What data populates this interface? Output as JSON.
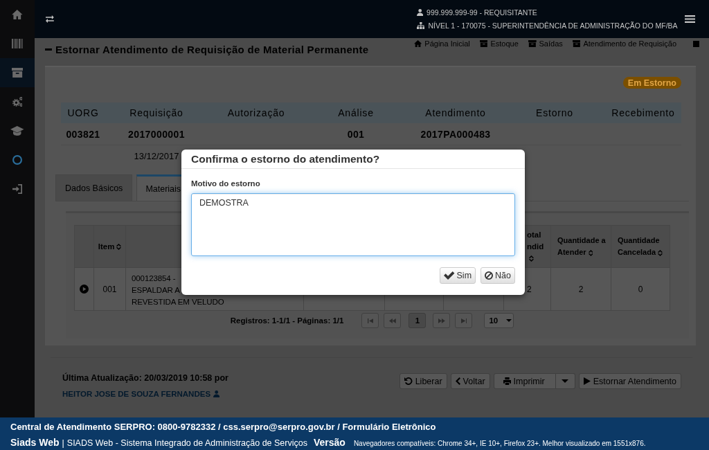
{
  "sidebar": {
    "items": [
      {
        "kind": "home",
        "selected": false
      },
      {
        "kind": "barcode",
        "selected": false
      },
      {
        "kind": "archive",
        "selected": true
      },
      {
        "kind": "gears",
        "selected": false
      },
      {
        "kind": "cap",
        "selected": false
      },
      {
        "kind": "ring",
        "selected": false
      },
      {
        "kind": "login",
        "selected": false
      }
    ]
  },
  "header": {
    "user": "999.999.999-99 - REQUISITANTE",
    "unit": "NÍVEL 1 - 170075 - SUPERINTENDÊNCIA DE ADMINISTRAÇÃO DO MF/BA"
  },
  "breadcrumb": [
    {
      "kind": "home",
      "label": "Página Inicial"
    },
    {
      "kind": "box",
      "label": "Estoque"
    },
    {
      "kind": "box",
      "label": "Saídas"
    },
    {
      "kind": "box",
      "label": "Atendimento de Requisição"
    }
  ],
  "page_title": "Estornar Atendimento de Requisição de Material Permanente",
  "status_badge": "Em Estorno",
  "summary": {
    "columns": [
      "UORG",
      "Requisição",
      "Autorização",
      "Análise",
      "Atendimento",
      "Estorno",
      "Recebimento"
    ],
    "rows": [
      {
        "kind": "values",
        "cells": [
          "003821",
          "2017000001",
          null,
          "001",
          "2017PA000483",
          null,
          null
        ]
      },
      {
        "kind": "dates",
        "cells": [
          null,
          "13/12/2017",
          null,
          null,
          null,
          null,
          null
        ]
      }
    ]
  },
  "tabs": [
    {
      "label": "Dados Básicos",
      "selected": false
    },
    {
      "label": "Materiais",
      "selected": true
    }
  ],
  "materials_table": {
    "columns": [
      {
        "sortable": false
      },
      {
        "label": "Item",
        "sortable": true
      },
      {
        "sortable": false
      },
      {
        "label": "otal ndid",
        "sortable": true
      },
      {
        "label": "Quantidade a Atender",
        "sortable": true
      },
      {
        "label": "Quantidade Cancelada",
        "sortable": true
      }
    ],
    "rows": [
      {
        "expanded": false,
        "cells": [
          null,
          "001",
          [
            "000123854 -",
            "ESPALDAR A",
            "REVESTIDA EM VELUDO"
          ],
          "2",
          "2",
          "0"
        ]
      }
    ]
  },
  "pagination": {
    "summary": "Registros: 1-1/1 - Páginas: 1/1",
    "buttons": [
      {
        "kind": "first",
        "disabled": true
      },
      {
        "kind": "prev",
        "disabled": true
      },
      {
        "kind": "page",
        "label": "1",
        "selected": true,
        "disabled": false
      },
      {
        "kind": "next",
        "disabled": true
      },
      {
        "kind": "last",
        "disabled": true
      }
    ],
    "page_size": "10"
  },
  "last_update": {
    "text": "Última Atualização: 20/03/2019 10:58 por",
    "user": "HEITOR JOSE DE SOUZA FERNANDES"
  },
  "actions": [
    {
      "kind": "undo",
      "label": "Liberar",
      "dropdown": false
    },
    {
      "kind": "back",
      "label": "Voltar",
      "dropdown": false
    },
    {
      "kind": "print",
      "label": "Imprimir",
      "dropdown": true
    },
    {
      "kind": "play",
      "label": "Estornar Atendimento",
      "dropdown": false
    }
  ],
  "footer": {
    "contact": "Central de Atendimento SERPRO: 0800-9782332 / css.serpro@serpro.gov.br / Formulário Eletrônico",
    "app_name": "Siads Web",
    "separator": "|",
    "app_description": "SIADS Web - Sistema Integrado de Administração de Serviços",
    "version_label": "Versão",
    "browsers": "Navegadores compatíveis: Chrome 34+, IE 10+, Firefox 23+. Melhor visualizado em 1551x876."
  },
  "dialog": {
    "title": "Confirma o estorno do atendimento?",
    "field_label": "Motivo do estorno",
    "reason": {
      "value": "DEMOSTRA",
      "focused": true
    },
    "buttons": [
      {
        "kind": "confirm",
        "label": "Sim"
      },
      {
        "kind": "cancel",
        "label": "Não"
      }
    ]
  }
}
